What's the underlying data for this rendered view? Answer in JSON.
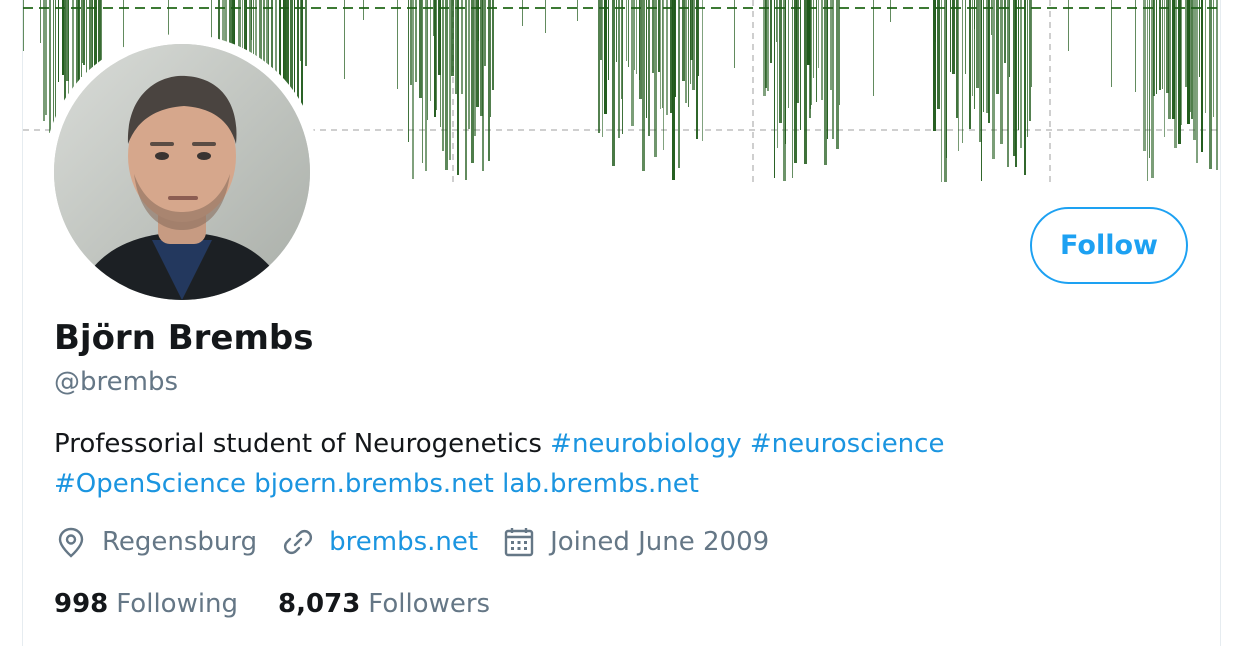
{
  "profile": {
    "name": "Björn Brembs",
    "handle": "@brembs",
    "bio_text": "Professorial student of Neurogenetics ",
    "bio_tag_1": "#neurobiology",
    "bio_tag_2": "#neuroscience",
    "bio_tag_3": "#OpenScience",
    "bio_link_1": "bjoern.brembs.net",
    "bio_link_2": "lab.brembs.net",
    "location": "Regensburg",
    "website": "brembs.net",
    "joined": "Joined June 2009"
  },
  "stats": {
    "following_count": "998",
    "following_label": "Following",
    "followers_count": "8,073",
    "followers_label": "Followers"
  },
  "actions": {
    "follow_label": "Follow"
  },
  "icons": {
    "location": "location-pin-icon",
    "website": "link-icon",
    "joined": "calendar-icon"
  },
  "colors": {
    "accent": "#1da1f2",
    "link": "#1b95e0",
    "secondary_text": "#657786",
    "banner_bar": "#1f5a1a"
  }
}
